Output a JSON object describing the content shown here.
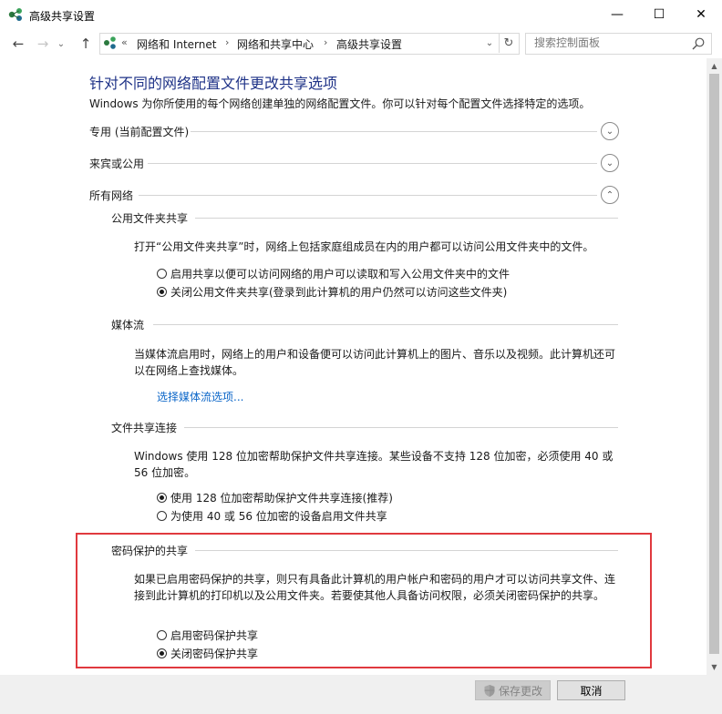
{
  "window": {
    "title": "高级共享设置",
    "minimize_glyph": "—",
    "maximize_glyph": "☐",
    "close_glyph": "✕"
  },
  "nav": {
    "back_glyph": "←",
    "forward_glyph": "→",
    "dropdown_glyph": "⌄",
    "up_glyph": "↑",
    "overflow": "«",
    "breadcrumb": [
      "网络和 Internet",
      "网络和共享中心",
      "高级共享设置"
    ],
    "crumb_sep": "›",
    "addr_dropdown_glyph": "⌄",
    "refresh_glyph": "↻"
  },
  "search": {
    "placeholder": "搜索控制面板",
    "value": ""
  },
  "page": {
    "heading": "针对不同的网络配置文件更改共享选项",
    "description": "Windows 为你所使用的每个网络创建单独的网络配置文件。你可以针对每个配置文件选择特定的选项。"
  },
  "profiles": {
    "private": {
      "label": "专用 (当前配置文件)",
      "chevron": "⌄"
    },
    "guest": {
      "label": "来宾或公用",
      "chevron": "⌄"
    },
    "all": {
      "label": "所有网络",
      "chevron": "⌃"
    }
  },
  "public_folder": {
    "title": "公用文件夹共享",
    "desc": "打开“公用文件夹共享”时，网络上包括家庭组成员在内的用户都可以访问公用文件夹中的文件。",
    "option_on": "启用共享以便可以访问网络的用户可以读取和写入公用文件夹中的文件",
    "option_off": "关闭公用文件夹共享(登录到此计算机的用户仍然可以访问这些文件夹)",
    "selected": "off"
  },
  "media": {
    "title": "媒体流",
    "desc": "当媒体流启用时，网络上的用户和设备便可以访问此计算机上的图片、音乐以及视频。此计算机还可以在网络上查找媒体。",
    "link": "选择媒体流选项..."
  },
  "file_sharing": {
    "title": "文件共享连接",
    "desc": "Windows 使用 128 位加密帮助保护文件共享连接。某些设备不支持 128 位加密，必须使用 40 或 56 位加密。",
    "option_128": "使用 128 位加密帮助保护文件共享连接(推荐)",
    "option_40_56": "为使用 40 或 56 位加密的设备启用文件共享",
    "selected": "128"
  },
  "password": {
    "title": "密码保护的共享",
    "desc": "如果已启用密码保护的共享，则只有具备此计算机的用户帐户和密码的用户才可以访问共享文件、连接到此计算机的打印机以及公用文件夹。若要使其他人具备访问权限，必须关闭密码保护的共享。",
    "option_on": "启用密码保护共享",
    "option_off": "关闭密码保护共享",
    "selected": "off"
  },
  "footer": {
    "save": "保存更改",
    "cancel": "取消"
  },
  "colors": {
    "heading": "#1e3287",
    "link": "#0b66c8",
    "highlight": "#e0393e"
  }
}
